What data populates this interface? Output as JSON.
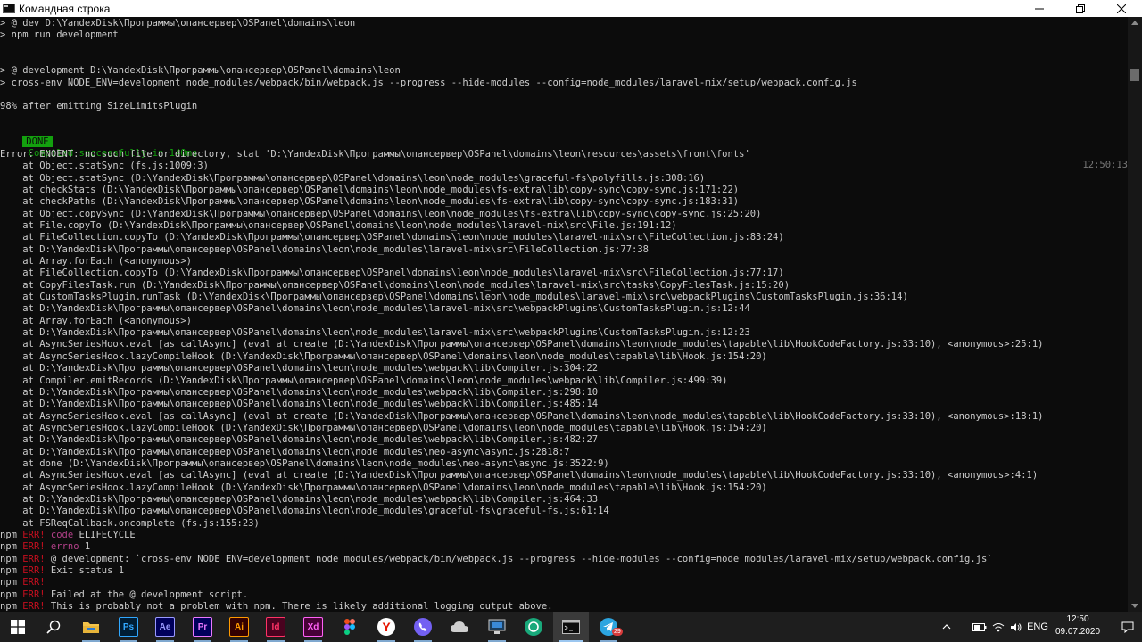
{
  "window": {
    "title": "Командная строка"
  },
  "console": {
    "lines": [
      {
        "row": 0,
        "text": "> @ dev D:\\YandexDisk\\Программы\\опансервер\\OSPanel\\domains\\leon"
      },
      {
        "row": 1,
        "text": "> npm run development"
      },
      {
        "row": 4,
        "text": "> @ development D:\\YandexDisk\\Программы\\опансервер\\OSPanel\\domains\\leon"
      },
      {
        "row": 5,
        "text": "> cross-env NODE_ENV=development node_modules/webpack/bin/webpack.js --progress --hide-modules --config=node_modules/laravel-mix/setup/webpack.config.js"
      },
      {
        "row": 7,
        "text": "98% after emitting SizeLimitsPlugin"
      },
      {
        "row": 11,
        "text": "Error: ENOENT: no such file or directory, stat 'D:\\YandexDisk\\Программы\\опансервер\\OSPanel\\domains\\leon\\resources\\assets\\front\\fonts'"
      },
      {
        "row": 12,
        "text": "    at Object.statSync (fs.js:1009:3)"
      },
      {
        "row": 13,
        "text": "    at Object.statSync (D:\\YandexDisk\\Программы\\опансервер\\OSPanel\\domains\\leon\\node_modules\\graceful-fs\\polyfills.js:308:16)"
      },
      {
        "row": 14,
        "text": "    at checkStats (D:\\YandexDisk\\Программы\\опансервер\\OSPanel\\domains\\leon\\node_modules\\fs-extra\\lib\\copy-sync\\copy-sync.js:171:22)"
      },
      {
        "row": 15,
        "text": "    at checkPaths (D:\\YandexDisk\\Программы\\опансервер\\OSPanel\\domains\\leon\\node_modules\\fs-extra\\lib\\copy-sync\\copy-sync.js:183:31)"
      },
      {
        "row": 16,
        "text": "    at Object.copySync (D:\\YandexDisk\\Программы\\опансервер\\OSPanel\\domains\\leon\\node_modules\\fs-extra\\lib\\copy-sync\\copy-sync.js:25:20)"
      },
      {
        "row": 17,
        "text": "    at File.copyTo (D:\\YandexDisk\\Программы\\опансервер\\OSPanel\\domains\\leon\\node_modules\\laravel-mix\\src\\File.js:191:12)"
      },
      {
        "row": 18,
        "text": "    at FileCollection.copyTo (D:\\YandexDisk\\Программы\\опансервер\\OSPanel\\domains\\leon\\node_modules\\laravel-mix\\src\\FileCollection.js:83:24)"
      },
      {
        "row": 19,
        "text": "    at D:\\YandexDisk\\Программы\\опансервер\\OSPanel\\domains\\leon\\node_modules\\laravel-mix\\src\\FileCollection.js:77:38"
      },
      {
        "row": 20,
        "text": "    at Array.forEach (<anonymous>)"
      },
      {
        "row": 21,
        "text": "    at FileCollection.copyTo (D:\\YandexDisk\\Программы\\опансервер\\OSPanel\\domains\\leon\\node_modules\\laravel-mix\\src\\FileCollection.js:77:17)"
      },
      {
        "row": 22,
        "text": "    at CopyFilesTask.run (D:\\YandexDisk\\Программы\\опансервер\\OSPanel\\domains\\leon\\node_modules\\laravel-mix\\src\\tasks\\CopyFilesTask.js:15:20)"
      },
      {
        "row": 23,
        "text": "    at CustomTasksPlugin.runTask (D:\\YandexDisk\\Программы\\опансервер\\OSPanel\\domains\\leon\\node_modules\\laravel-mix\\src\\webpackPlugins\\CustomTasksPlugin.js:36:14)"
      },
      {
        "row": 24,
        "text": "    at D:\\YandexDisk\\Программы\\опансервер\\OSPanel\\domains\\leon\\node_modules\\laravel-mix\\src\\webpackPlugins\\CustomTasksPlugin.js:12:44"
      },
      {
        "row": 25,
        "text": "    at Array.forEach (<anonymous>)"
      },
      {
        "row": 26,
        "text": "    at D:\\YandexDisk\\Программы\\опансервер\\OSPanel\\domains\\leon\\node_modules\\laravel-mix\\src\\webpackPlugins\\CustomTasksPlugin.js:12:23"
      },
      {
        "row": 27,
        "text": "    at AsyncSeriesHook.eval [as callAsync] (eval at create (D:\\YandexDisk\\Программы\\опансервер\\OSPanel\\domains\\leon\\node_modules\\tapable\\lib\\HookCodeFactory.js:33:10), <anonymous>:25:1)"
      },
      {
        "row": 28,
        "text": "    at AsyncSeriesHook.lazyCompileHook (D:\\YandexDisk\\Программы\\опансервер\\OSPanel\\domains\\leon\\node_modules\\tapable\\lib\\Hook.js:154:20)"
      },
      {
        "row": 29,
        "text": "    at D:\\YandexDisk\\Программы\\опансервер\\OSPanel\\domains\\leon\\node_modules\\webpack\\lib\\Compiler.js:304:22"
      },
      {
        "row": 30,
        "text": "    at Compiler.emitRecords (D:\\YandexDisk\\Программы\\опансервер\\OSPanel\\domains\\leon\\node_modules\\webpack\\lib\\Compiler.js:499:39)"
      },
      {
        "row": 31,
        "text": "    at D:\\YandexDisk\\Программы\\опансервер\\OSPanel\\domains\\leon\\node_modules\\webpack\\lib\\Compiler.js:298:10"
      },
      {
        "row": 32,
        "text": "    at D:\\YandexDisk\\Программы\\опансервер\\OSPanel\\domains\\leon\\node_modules\\webpack\\lib\\Compiler.js:485:14"
      },
      {
        "row": 33,
        "text": "    at AsyncSeriesHook.eval [as callAsync] (eval at create (D:\\YandexDisk\\Программы\\опансервер\\OSPanel\\domains\\leon\\node_modules\\tapable\\lib\\HookCodeFactory.js:33:10), <anonymous>:18:1)"
      },
      {
        "row": 34,
        "text": "    at AsyncSeriesHook.lazyCompileHook (D:\\YandexDisk\\Программы\\опансервер\\OSPanel\\domains\\leon\\node_modules\\tapable\\lib\\Hook.js:154:20)"
      },
      {
        "row": 35,
        "text": "    at D:\\YandexDisk\\Программы\\опансервер\\OSPanel\\domains\\leon\\node_modules\\webpack\\lib\\Compiler.js:482:27"
      },
      {
        "row": 36,
        "text": "    at D:\\YandexDisk\\Программы\\опансервер\\OSPanel\\domains\\leon\\node_modules\\neo-async\\async.js:2818:7"
      },
      {
        "row": 37,
        "text": "    at done (D:\\YandexDisk\\Программы\\опансервер\\OSPanel\\domains\\leon\\node_modules\\neo-async\\async.js:3522:9)"
      },
      {
        "row": 38,
        "text": "    at AsyncSeriesHook.eval [as callAsync] (eval at create (D:\\YandexDisk\\Программы\\опансервер\\OSPanel\\domains\\leon\\node_modules\\tapable\\lib\\HookCodeFactory.js:33:10), <anonymous>:4:1)"
      },
      {
        "row": 39,
        "text": "    at AsyncSeriesHook.lazyCompileHook (D:\\YandexDisk\\Программы\\опансервер\\OSPanel\\domains\\leon\\node_modules\\tapable\\lib\\Hook.js:154:20)"
      },
      {
        "row": 40,
        "text": "    at D:\\YandexDisk\\Программы\\опансервер\\OSPanel\\domains\\leon\\node_modules\\webpack\\lib\\Compiler.js:464:33"
      },
      {
        "row": 41,
        "text": "    at D:\\YandexDisk\\Программы\\опансервер\\OSPanel\\domains\\leon\\node_modules\\graceful-fs\\graceful-fs.js:61:14"
      },
      {
        "row": 42,
        "text": "    at FSReqCallback.oncomplete (fs.js:155:23)"
      }
    ],
    "done_line": {
      "row": 9,
      "badge": "DONE",
      "message": "Compiled successfully in 140ms",
      "time": "12:50:13"
    },
    "npm_prefix": "npm",
    "npm_err_label": "ERR!",
    "npm_err_lines": [
      {
        "row": 43,
        "kw": "code",
        "text": " ELIFECYCLE"
      },
      {
        "row": 44,
        "kw": "errno",
        "text": " 1"
      },
      {
        "row": 45,
        "kw": "",
        "text": " @ development: `cross-env NODE_ENV=development node_modules/webpack/bin/webpack.js --progress --hide-modules --config=node_modules/laravel-mix/setup/webpack.config.js`"
      },
      {
        "row": 46,
        "kw": "",
        "text": " Exit status 1"
      },
      {
        "row": 47,
        "kw": "",
        "text": ""
      },
      {
        "row": 48,
        "kw": "",
        "text": " Failed at the @ development script."
      },
      {
        "row": 49,
        "kw": "",
        "text": " This is probably not a problem with npm. There is likely additional logging output above."
      }
    ]
  },
  "taskbar": {
    "apps": [
      {
        "name": "windows-start-icon",
        "kind": "start"
      },
      {
        "name": "search-icon",
        "kind": "search"
      },
      {
        "name": "file-explorer-icon",
        "kind": "folder"
      },
      {
        "name": "photoshop-icon",
        "label": "Ps",
        "bg": "#001d34",
        "fg": "#31a8ff"
      },
      {
        "name": "after-effects-icon",
        "label": "Ae",
        "bg": "#00005b",
        "fg": "#9999ff"
      },
      {
        "name": "premiere-icon",
        "label": "Pr",
        "bg": "#00005b",
        "fg": "#ea77ff"
      },
      {
        "name": "illustrator-icon",
        "label": "Ai",
        "bg": "#330000",
        "fg": "#ff9a00"
      },
      {
        "name": "indesign-icon",
        "label": "Id",
        "bg": "#49021f",
        "fg": "#ff3366"
      },
      {
        "name": "xd-icon",
        "label": "Xd",
        "bg": "#470137",
        "fg": "#ff61f6"
      },
      {
        "name": "figma-icon",
        "kind": "figma"
      },
      {
        "name": "yandex-browser-icon",
        "kind": "yandex"
      },
      {
        "name": "viber-icon",
        "kind": "viber"
      },
      {
        "name": "cloud-app-icon",
        "kind": "cloud"
      },
      {
        "name": "remote-desktop-icon",
        "kind": "monitor"
      },
      {
        "name": "chatgpt-icon",
        "kind": "green-circle"
      },
      {
        "name": "command-prompt-icon",
        "kind": "cmd",
        "active": true
      },
      {
        "name": "telegram-icon",
        "kind": "telegram",
        "badge": "29"
      }
    ],
    "tray": {
      "language": "ENG",
      "time": "12:50",
      "date": "09.07.2020"
    }
  }
}
